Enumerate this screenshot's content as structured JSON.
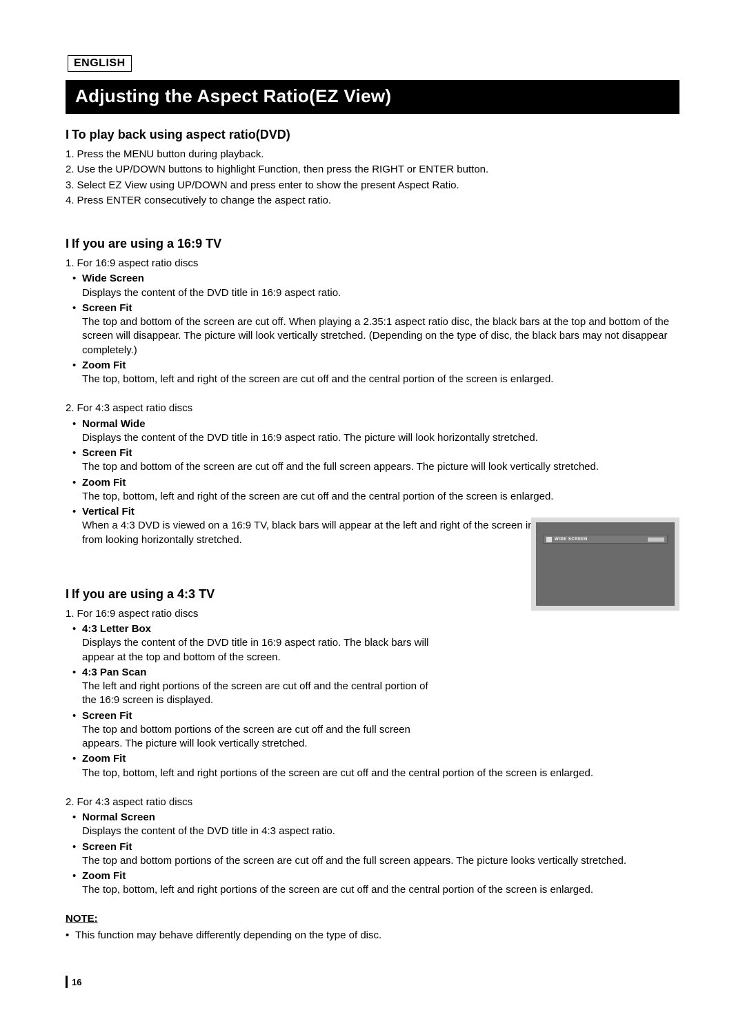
{
  "lang": "ENGLISH",
  "title": "Adjusting the Aspect Ratio(EZ View)",
  "sec1": {
    "head": "To play back using aspect ratio(DVD)",
    "steps": [
      "Press the MENU button during playback.",
      "Use the UP/DOWN buttons to highlight Function, then press the RIGHT or ENTER button.",
      "Select EZ View using UP/DOWN and press enter to show the present Aspect Ratio.",
      "Press ENTER consecutively to change the aspect ratio."
    ]
  },
  "sec2": {
    "head": "If you are using a 16:9 TV",
    "g1": {
      "lead": "For 16:9 aspect ratio discs",
      "items": [
        {
          "t": "Wide Screen",
          "d": "Displays the content of the DVD title in 16:9 aspect ratio."
        },
        {
          "t": "Screen Fit",
          "d": "The top and bottom of the screen are cut off. When playing a 2.35:1 aspect ratio disc, the black bars at the top and bottom of the screen will disappear. The picture will look vertically stretched. (Depending on the type of disc, the black bars may not disappear completely.)"
        },
        {
          "t": "Zoom Fit",
          "d": "The top, bottom, left and right of the screen are cut off and the central portion of the screen is enlarged."
        }
      ]
    },
    "g2": {
      "lead": "For 4:3 aspect ratio discs",
      "items": [
        {
          "t": "Normal Wide",
          "d": "Displays the content of the DVD title in 16:9 aspect ratio. The picture will look horizontally stretched."
        },
        {
          "t": "Screen Fit",
          "d": "The top and bottom of the screen are cut off and the full screen appears. The picture will look vertically stretched."
        },
        {
          "t": "Zoom Fit",
          "d": "The top, bottom, left and right of the screen are cut off and the central portion of the screen is enlarged."
        },
        {
          "t": "Vertical Fit",
          "d": "When a 4:3 DVD is viewed on a 16:9 TV, black bars will appear at the left and right of the screen in order to prevent the picture from looking horizontally stretched."
        }
      ]
    }
  },
  "sec3": {
    "head": "If you are using a 4:3 TV",
    "g1": {
      "lead": "For 16:9 aspect ratio discs",
      "items": [
        {
          "t": "4:3 Letter Box",
          "d": "Displays the content of the DVD title in 16:9 aspect ratio. The black bars will appear at the top and bottom of the screen."
        },
        {
          "t": "4:3 Pan Scan",
          "d": "The left and right portions of the screen are cut off and the central portion of the 16:9 screen is displayed."
        },
        {
          "t": "Screen Fit",
          "d": "The top and bottom portions of the screen are cut off and the full screen appears. The picture will look vertically stretched."
        },
        {
          "t": "Zoom Fit",
          "d": "The top, bottom, left and right portions of the screen are cut off and the central portion of the screen is enlarged."
        }
      ]
    },
    "g2": {
      "lead": "For 4:3 aspect ratio discs",
      "items": [
        {
          "t": "Normal Screen",
          "d": "Displays the content of the DVD title in 4:3 aspect ratio."
        },
        {
          "t": "Screen Fit",
          "d": "The top and bottom portions of the screen are cut off and the full screen appears. The picture looks vertically stretched."
        },
        {
          "t": "Zoom Fit",
          "d": "The top, bottom, left and right portions of the screen are cut off and the central portion of the screen is enlarged."
        }
      ]
    }
  },
  "note": {
    "head": "NOTE:",
    "text": "This function may behave differently depending on the type of disc."
  },
  "osd": "WIDE SCREEN",
  "pageNumber": "16"
}
